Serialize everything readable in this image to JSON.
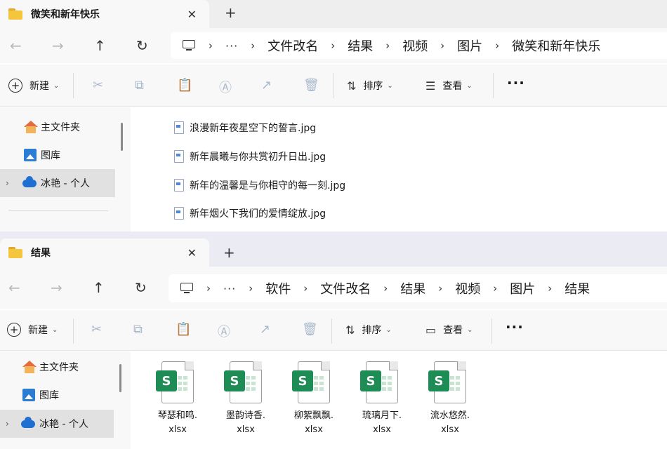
{
  "colors": {
    "accent_blue": "#1e6fd1",
    "excel_green": "#1d8c55",
    "folder_yellow": "#f5c63d"
  },
  "window1": {
    "tab": {
      "title": "微笑和新年快乐",
      "close": "✕",
      "new_tab": "+"
    },
    "nav": {
      "back": "←",
      "forward": "→",
      "up": "↑",
      "refresh": "↻",
      "more": "···",
      "breadcrumb": [
        "文件改名",
        "结果",
        "视频",
        "图片",
        "微笑和新年快乐"
      ]
    },
    "toolbar": {
      "new_label": "新建",
      "sort_label": "排序",
      "view_label": "查看",
      "more": "···"
    },
    "sidebar": {
      "items": [
        {
          "label": "主文件夹",
          "icon": "home-icon"
        },
        {
          "label": "图库",
          "icon": "gallery-icon"
        },
        {
          "label": "冰艳 - 个人",
          "icon": "cloud-icon"
        }
      ]
    },
    "files": [
      "浪漫新年夜星空下的誓言.jpg",
      "新年晨曦与你共赏初升日出.jpg",
      "新年的温馨是与你相守的每一刻.jpg",
      "新年烟火下我们的爱情绽放.jpg"
    ]
  },
  "window2": {
    "tab": {
      "title": "结果",
      "close": "✕",
      "new_tab": "+"
    },
    "nav": {
      "back": "←",
      "forward": "→",
      "up": "↑",
      "refresh": "↻",
      "more": "···",
      "breadcrumb": [
        "软件",
        "文件改名",
        "结果",
        "视频",
        "图片",
        "结果"
      ]
    },
    "toolbar": {
      "new_label": "新建",
      "sort_label": "排序",
      "view_label": "查看",
      "more": "···"
    },
    "sidebar": {
      "items": [
        {
          "label": "主文件夹",
          "icon": "home-icon"
        },
        {
          "label": "图库",
          "icon": "gallery-icon"
        },
        {
          "label": "冰艳 - 个人",
          "icon": "cloud-icon"
        }
      ]
    },
    "files": [
      {
        "name_line1": "琴瑟和鸣.",
        "name_line2": "xlsx",
        "badge": "S"
      },
      {
        "name_line1": "墨韵诗香.",
        "name_line2": "xlsx",
        "badge": "S"
      },
      {
        "name_line1": "柳絮飘飘.",
        "name_line2": "xlsx",
        "badge": "S"
      },
      {
        "name_line1": "琉璃月下.",
        "name_line2": "xlsx",
        "badge": "S"
      },
      {
        "name_line1": "流水悠然.",
        "name_line2": "xlsx",
        "badge": "S"
      }
    ]
  }
}
